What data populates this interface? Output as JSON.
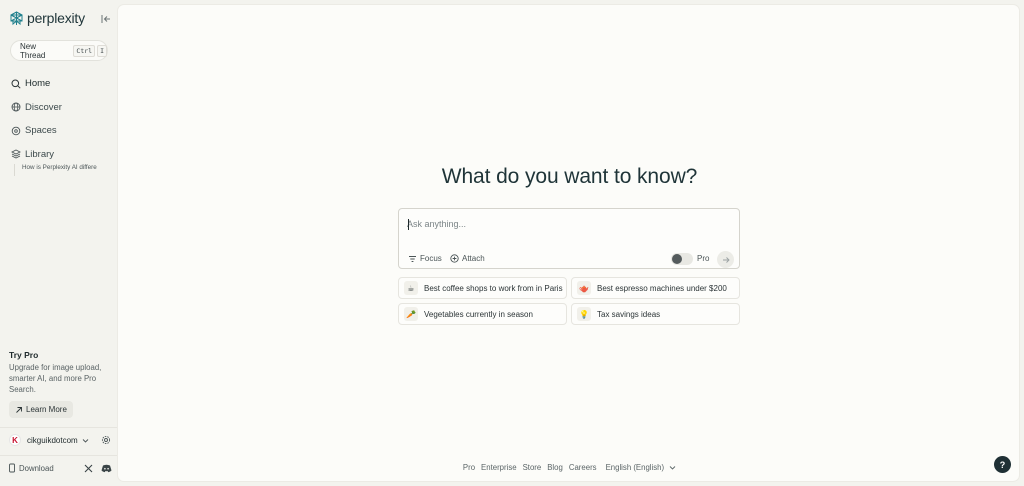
{
  "brand": {
    "name": "perplexity",
    "accent": "#20808d"
  },
  "sidebar": {
    "new_thread_label": "New Thread",
    "shortcut_keys": [
      "Ctrl",
      "I"
    ],
    "nav": [
      {
        "label": "Home",
        "icon": "search-icon",
        "active": true
      },
      {
        "label": "Discover",
        "icon": "globe-icon",
        "active": false
      },
      {
        "label": "Spaces",
        "icon": "spaces-icon",
        "active": false
      },
      {
        "label": "Library",
        "icon": "library-icon",
        "active": false
      }
    ],
    "history": [
      "How is Perplexity AI differe"
    ],
    "try_pro": {
      "title": "Try Pro",
      "description": "Upgrade for image upload, smarter AI, and more Pro Search.",
      "button": "Learn More"
    },
    "account": {
      "username": "cikguikdotcom",
      "avatar_letter": "K"
    },
    "download_label": "Download"
  },
  "main": {
    "headline": "What do you want to know?",
    "search": {
      "placeholder": "Ask anything...",
      "value": "",
      "focus_label": "Focus",
      "attach_label": "Attach",
      "pro_label": "Pro",
      "pro_enabled": false
    },
    "suggestions": [
      {
        "emoji": "☕",
        "label": "Best coffee shops to work from in Paris"
      },
      {
        "emoji": "🫖",
        "label": "Best espresso machines under $200"
      },
      {
        "emoji": "🥕",
        "label": "Vegetables currently in season"
      },
      {
        "emoji": "💡",
        "label": "Tax savings ideas"
      }
    ],
    "footer": [
      "Pro",
      "Enterprise",
      "Store",
      "Blog",
      "Careers",
      "English (English)"
    ],
    "help_label": "?"
  }
}
